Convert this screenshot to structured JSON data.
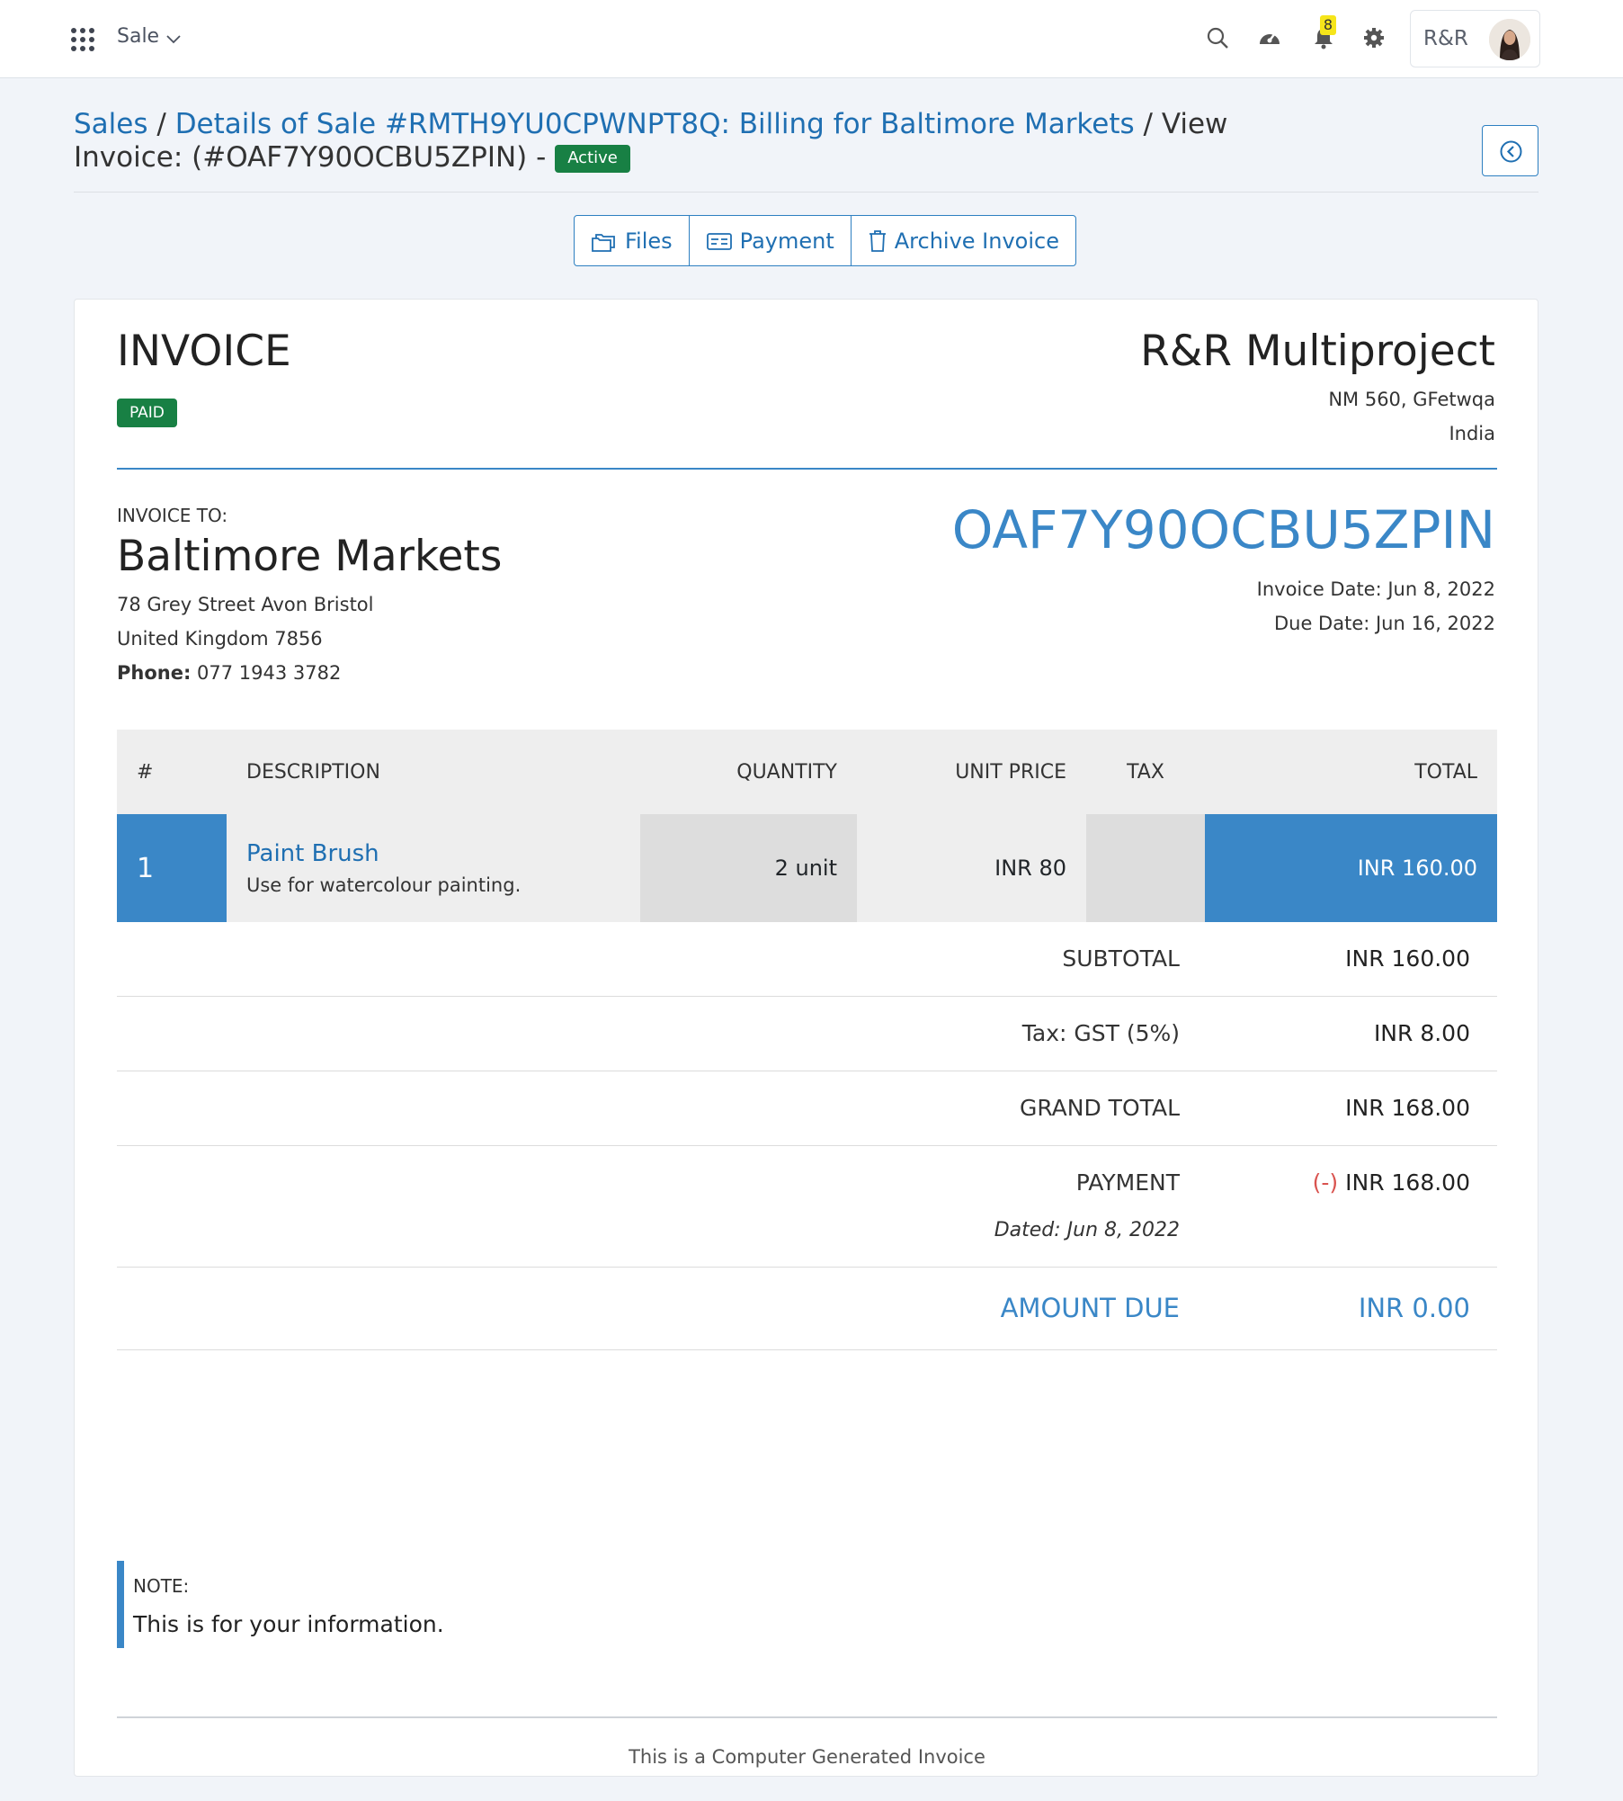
{
  "topbar": {
    "module": "Sale",
    "notification_count": "8",
    "user_initials": "R&R"
  },
  "breadcrumb": {
    "sales": "Sales",
    "sale_details": "Details of Sale #RMTH9YU0CPWNPT8Q: Billing for Baltimore Markets",
    "view_invoice": "View Invoice: (#OAF7Y90OCBU5ZPIN) -",
    "status": "Active"
  },
  "actions": {
    "files": "Files",
    "payment": "Payment",
    "archive": "Archive Invoice"
  },
  "invoice": {
    "title": "INVOICE",
    "paid_badge": "PAID",
    "company": {
      "name": "R&R Multiproject",
      "address_line1": "NM 560, GFetwqa",
      "address_line2": "India"
    },
    "bill_to": {
      "label": "INVOICE TO:",
      "name": "Baltimore Markets",
      "address_line1": "78 Grey Street Avon Bristol",
      "address_line2": "United Kingdom 7856",
      "phone_label": "Phone:",
      "phone": "077 1943 3782"
    },
    "number": "OAF7Y90OCBU5ZPIN",
    "invoice_date": "Invoice Date: Jun 8, 2022",
    "due_date": "Due Date: Jun 16, 2022",
    "table": {
      "headers": {
        "num": "#",
        "description": "DESCRIPTION",
        "quantity": "QUANTITY",
        "unit_price": "UNIT PRICE",
        "tax": "TAX",
        "total": "TOTAL"
      },
      "rows": [
        {
          "num": "1",
          "name": "Paint Brush",
          "description": "Use for watercolour painting.",
          "quantity": "2 unit",
          "unit_price": "INR 80",
          "tax": "",
          "total": "INR 160.00"
        }
      ]
    },
    "totals": {
      "subtotal_label": "SUBTOTAL",
      "subtotal": "INR 160.00",
      "tax_label": "Tax: GST (5%)",
      "tax": "INR 8.00",
      "grand_total_label": "GRAND TOTAL",
      "grand_total": "INR 168.00",
      "payment_label": "PAYMENT",
      "payment_sign": "(-)",
      "payment": "INR 168.00",
      "payment_dated": "Dated: Jun 8, 2022",
      "amount_due_label": "AMOUNT DUE",
      "amount_due": "INR 0.00"
    },
    "note": {
      "label": "NOTE:",
      "text": "This is for your information."
    },
    "footer": "This is a Computer Generated Invoice"
  },
  "colors": {
    "accent": "#3a87c7",
    "link": "#1f6fb2",
    "success": "#188044"
  }
}
